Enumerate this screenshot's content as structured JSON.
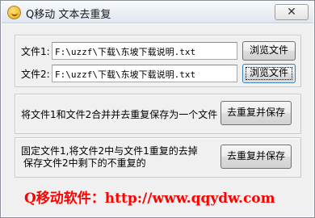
{
  "window": {
    "title": "Q移动 文本去重复",
    "close_label": "✕"
  },
  "files": {
    "file1_label": "文件1:",
    "file1_value": "F:\\uzzf\\下载\\东坡下载说明.txt",
    "file2_label": "文件2:",
    "file2_value": "F:\\uzzf\\下载\\东坡下载说明.txt",
    "browse_label": "浏览文件"
  },
  "merge": {
    "description": "将文件1和文件2合并并去重复保存为一个文件",
    "button_label": "去重复并保存"
  },
  "fixed": {
    "description_line1": "固定文件1,将文件2中与文件1重复的去掉",
    "description_line2": "保存文件2中剩下的不重复的",
    "button_label": "去重复并保存"
  },
  "footer": {
    "text": "Q移动软件：http://www.qqydw.com"
  },
  "colors": {
    "footer_text": "#ff0000",
    "window_bg": "#f0f0f0",
    "focus_border": "#3c7fb1"
  }
}
